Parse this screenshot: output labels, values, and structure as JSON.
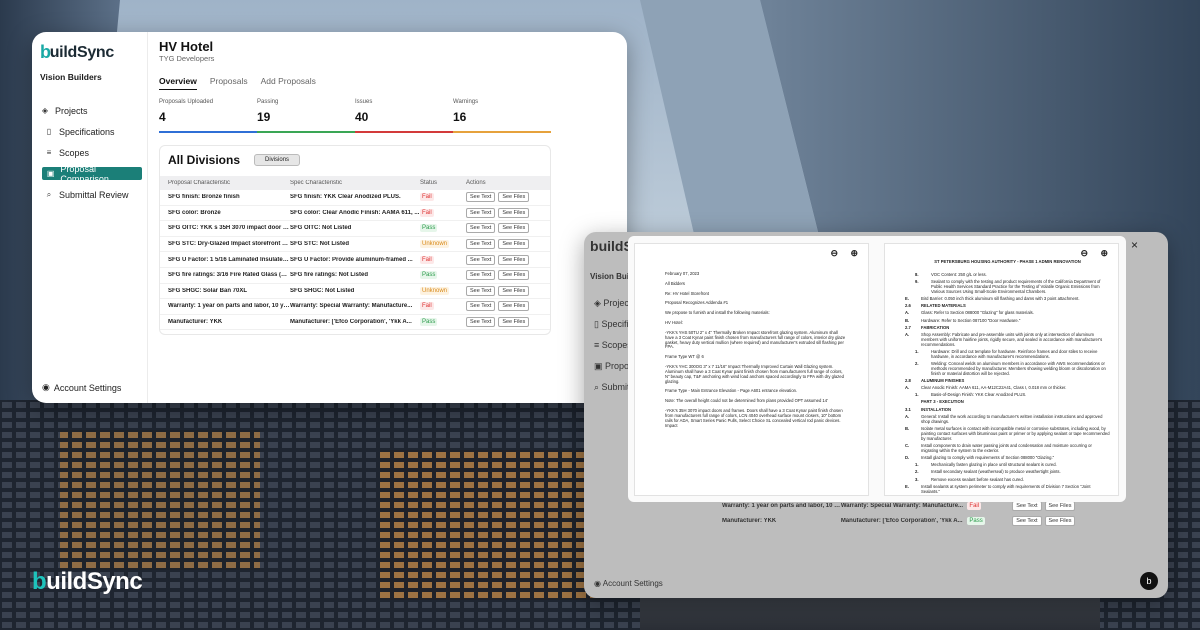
{
  "brand": {
    "logo_b": "b",
    "logo_rest": "uildSync",
    "accent": "#1aa9a5"
  },
  "sidebar": {
    "org": "Vision Builders",
    "items": [
      {
        "label": "Projects",
        "icon": "layers-icon"
      },
      {
        "label": "Specifications",
        "icon": "file-icon"
      },
      {
        "label": "Scopes",
        "icon": "list-icon"
      },
      {
        "label": "Proposal Comparison",
        "icon": "compare-icon"
      },
      {
        "label": "Submittal Review",
        "icon": "search-icon"
      }
    ],
    "account": "Account Settings"
  },
  "project": {
    "title": "HV Hotel",
    "subtitle": "TYG Developers"
  },
  "tabs": [
    "Overview",
    "Proposals",
    "Add Proposals"
  ],
  "stats": [
    {
      "label": "Proposals Uploaded",
      "value": "4",
      "color": "#2f6fd6"
    },
    {
      "label": "Passing",
      "value": "19",
      "color": "#3aa655"
    },
    {
      "label": "Issues",
      "value": "40",
      "color": "#d33a3a"
    },
    {
      "label": "Warnings",
      "value": "16",
      "color": "#e6a23c"
    }
  ],
  "divisions": {
    "title": "All Divisions",
    "pill": "Divisions",
    "headers": [
      "Proposal Characteristic",
      "Spec Characteristic",
      "Status",
      "Actions"
    ],
    "see_text": "See Text",
    "see_files": "See Files",
    "rows": [
      {
        "proposal": "SFG finish: Bronze finish",
        "spec": "SFG finish: YKK Clear Anodized PLUS.",
        "status": "Fail"
      },
      {
        "proposal": "SFG color: Bronze",
        "spec": "SFG color: Clear Anodic Finish: AAMA 611, ...",
        "status": "Fail"
      },
      {
        "proposal": "SFG OITC: YKK s 35H 3070 impact door a...",
        "spec": "SFG OITC: Not Listed",
        "status": "Pass"
      },
      {
        "proposal": "SFG STC: Dry-Glazed Impact storefront g...",
        "spec": "SFG STC: Not Listed",
        "status": "Unknown"
      },
      {
        "proposal": "SFG U Factor: 1 5/16 Laminated Insulated I...",
        "spec": "SFG U Factor: Provide aluminum-framed ...",
        "status": "Fail"
      },
      {
        "proposal": "SFG fire ratings: 3/16 Fire Rated Glass (45 ...",
        "spec": "SFG fire ratings: Not Listed",
        "status": "Pass"
      },
      {
        "proposal": "SFG SHGC: Solar Ban 70XL",
        "spec": "SFG SHGC: Not Listed",
        "status": "Unknown"
      },
      {
        "proposal": "Warranty: 1 year on parts and labor, 10 yea...",
        "spec": "Warranty: Special Warranty: Manufacture...",
        "status": "Fail"
      },
      {
        "proposal": "Manufacturer: YKK",
        "spec": "Manufacturer: ['Efco Corporation', 'Ykk A...",
        "status": "Pass"
      }
    ]
  },
  "ghost": {
    "org": "Vision Builders",
    "rows": [
      {
        "proposal": "Warranty: 1 year on parts and labor, 10 yea...",
        "spec": "Warranty: Special Warranty: Manufacture...",
        "status": "Fail"
      },
      {
        "proposal": "Manufacturer: YKK",
        "spec": "Manufacturer: ['Efco Corporation', 'Ykk A...",
        "status": "Pass"
      }
    ]
  },
  "viewer": {
    "close": "×",
    "left_doc": [
      "February 07, 2023",
      "All Bidders",
      "Re: HV Hotel Storefront",
      "Proposal Recognizes Addenda #1",
      "We propose to furnish and install the following materials:",
      "HV Hotel:",
      "-YKK's YHS 50TU 2\" x 4\" Thermally Broken Impact storefront glazing system. Aluminum shall have a 3 Coat Kynar paint finish chosen from manufacturers full range of colors, interior dry glaze gasket, heavy duty vertical mullion (where required) and manufacturer's extruded sill flashing per FPA.",
      "Frame Type WT @ 6",
      "-YKK's YHC 300OG 3\" x 7 11/16\" Impact Thermally Improved Curtain Wall Glazing system. Aluminum shall have a 3 Coat Kynar paint finish chosen from manufacturers full range of colors, N\" beauty cap, T&F anchoring with wind load anchors spaced accordingly to FPA with dry glazed glazing.",
      "Frame Type - Main Entrance Elevation - Page A601 entrance elevation.",
      "Note: The overall height could not be determined from plans provided OPT assumed 14'",
      "-YKK's 35H 3070 impact doors and frames. Doors shall have a 3 Coat Kynar paint finish chosen from manufacturers full range of colors, LCN 4040 overhead surface mount closers, 10\" bottom rails for ADA, Smart Series Panic Pulls, Select Choice SL concealed vertical rod panic devices. Impact"
    ],
    "right_doc": {
      "header": "ST PETERSBURG HOUSING AUTHORITY - PHASE 1 ADMIN RENOVATION",
      "lines": [
        {
          "n": "8.",
          "t": "VOC Content: 250 g/L or less.",
          "ind": true
        },
        {
          "n": "9.",
          "t": "Sealant to comply with the testing and product requirements of the California Department of Public Health Services Standard Practice for the Testing of Volatile Organic Emissions from Various Sources Using Small-Scale Environmental Chambers.",
          "ind": true
        },
        {
          "n": "E.",
          "t": "Bird Barrier: 0.050 inch thick aluminum sill flashing and dams with 3 point attachment.",
          "ind": false
        },
        {
          "n": "2.6",
          "t": "RELATED MATERIALS",
          "sec": true
        },
        {
          "n": "A.",
          "t": "Glass: Refer to Section 088000 \"Glazing\" for glass materials.",
          "ind": false
        },
        {
          "n": "B.",
          "t": "Hardware: Refer to Section 087100 \"Door Hardware.\"",
          "ind": false
        },
        {
          "n": "2.7",
          "t": "FABRICATION",
          "sec": true
        },
        {
          "n": "A.",
          "t": "Shop Assembly: Fabricate and pre-assemble units with joints only at intersection of aluminum members with uniform hairline joints, rigidly secure, and sealed in accordance with manufacturer's recommendations.",
          "ind": false
        },
        {
          "n": "1.",
          "t": "Hardware: Drill and cut template for hardware. Reinforce frames and door stiles to receive hardware, in accordance with manufacturer's recommendations.",
          "ind": true
        },
        {
          "n": "2.",
          "t": "Welding: Conceal welds on aluminum members in accordance with AWS recommendations or methods recommended by manufacturer. Members showing welding bloom or discoloration on finish or material distortion will be rejected.",
          "ind": true
        },
        {
          "n": "2.8",
          "t": "ALUMINUM FINISHES",
          "sec": true
        },
        {
          "n": "A.",
          "t": "Clear Anodic Finish: AAMA 611, AA-M12C22A41, Class I, 0.018 mm or thicker.",
          "ind": false
        },
        {
          "n": "1.",
          "t": "Basis-of-Design Finish: YKK Clear Anodized PLUS.",
          "ind": true
        },
        {
          "n": "",
          "t": "PART 3 - EXECUTION",
          "sec": true
        },
        {
          "n": "3.1",
          "t": "INSTALLATION",
          "sec": true
        },
        {
          "n": "A.",
          "t": "General: Install the work according to manufacturer's written installation instructions and approved shop drawings.",
          "ind": false
        },
        {
          "n": "B.",
          "t": "Isolate metal surfaces in contact with incompatible metal or corrosive substrates, including wood, by painting contact surfaces with bituminous paint or primer or by applying sealant or tape recommended by manufacturer.",
          "ind": false
        },
        {
          "n": "C.",
          "t": "Install components to drain water passing joints and condensation and moisture occurring or migrating within the system to the exterior.",
          "ind": false
        },
        {
          "n": "D.",
          "t": "Install glazing to comply with requirements of Section 088000 \"Glazing.\"",
          "ind": false
        },
        {
          "n": "1.",
          "t": "Mechanically fasten glazing in place until structural sealant is cured.",
          "ind": true
        },
        {
          "n": "2.",
          "t": "Install secondary sealant (weatherseal) to produce weathertight joints.",
          "ind": true
        },
        {
          "n": "3.",
          "t": "Remove excess sealant before sealant has cured.",
          "ind": true
        },
        {
          "n": "E.",
          "t": "Install sealants at system perimeter to comply with requirements of Division 7 Section \"Joint Sealants.\"",
          "ind": false
        },
        {
          "n": "F.",
          "t": "Install framing components true in alignment with established lines and grades to the following tolerances:",
          "ind": false
        },
        {
          "n": "1.",
          "t": "Variation from Plane: Limit to 1/8 inch in 12 feet; 1/4 inch over total length.",
          "ind": true
        }
      ]
    }
  }
}
